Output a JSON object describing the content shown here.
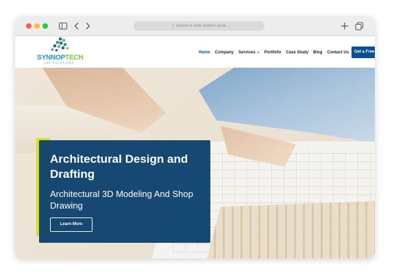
{
  "browser": {
    "address_placeholder": "Search or enter website name"
  },
  "site": {
    "logo_main": "SYNNOP",
    "logo_accent": "TECH",
    "logo_sub": "CAD SOLUTIONS",
    "nav": [
      {
        "label": "Home",
        "active": true
      },
      {
        "label": "Company"
      },
      {
        "label": "Services",
        "has_dropdown": true
      },
      {
        "label": "Portfolio"
      },
      {
        "label": "Case Study"
      },
      {
        "label": "Blog"
      },
      {
        "label": "Contact Us"
      }
    ],
    "cta_label": "Get a Free"
  },
  "hero": {
    "title": "Architectural Design and Drafting",
    "subtitle": "Architectural 3D Modeling And Shop Drawing",
    "button_label": "Learn More"
  },
  "colors": {
    "brand_blue": "#0a4f8f",
    "card_bg": "#0b3f6e",
    "accent_yellow": "#d8dc1f",
    "logo_green": "#7dc242",
    "logo_blue": "#2b8fd0"
  }
}
